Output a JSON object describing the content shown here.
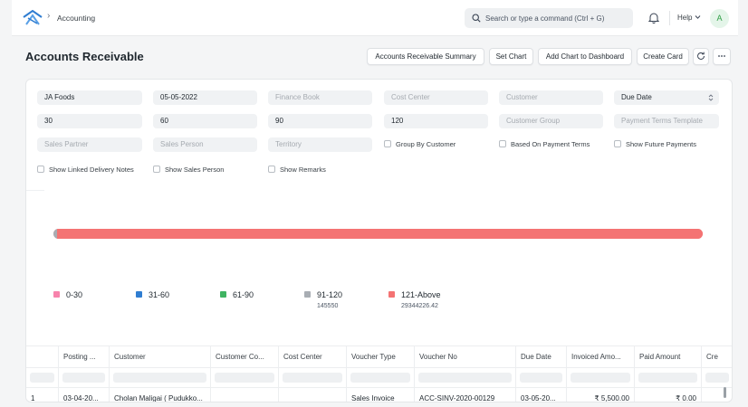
{
  "navbar": {
    "breadcrumb": "Accounting",
    "search_placeholder": "Search or type a command (Ctrl + G)",
    "help_label": "Help",
    "avatar_initial": "A"
  },
  "page": {
    "title": "Accounts Receivable",
    "buttons": {
      "summary": "Accounts Receivable Summary",
      "set_chart": "Set Chart",
      "add_chart": "Add Chart to Dashboard",
      "create_card": "Create Card"
    }
  },
  "filters": {
    "company": "JA Foods",
    "date": "05-05-2022",
    "finance_book": "Finance Book",
    "cost_center": "Cost Center",
    "customer": "Customer",
    "ageing_based_on": "Due Date",
    "range1": "30",
    "range2": "60",
    "range3": "90",
    "range4": "120",
    "customer_group": "Customer Group",
    "payment_terms_template": "Payment Terms Template",
    "sales_partner": "Sales Partner",
    "sales_person": "Sales Person",
    "territory": "Territory",
    "group_by_customer": "Group By Customer",
    "based_on_payment_terms": "Based On Payment Terms",
    "show_future_payments": "Show Future Payments",
    "show_linked_delivery_notes": "Show Linked Delivery Notes",
    "show_sales_person": "Show Sales Person",
    "show_remarks": "Show Remarks"
  },
  "chart_data": {
    "type": "bar",
    "orientation": "horizontal-stacked",
    "categories": [
      "0-30",
      "31-60",
      "61-90",
      "91-120",
      "121-Above"
    ],
    "values": [
      0,
      0,
      0,
      145550,
      29344226.42
    ],
    "value_labels": [
      "",
      "",
      "",
      "145550",
      "29344226.42"
    ],
    "colors": [
      "#f783ac",
      "#2f7dd1",
      "#3fb362",
      "#a8adb3",
      "#f47373"
    ]
  },
  "table": {
    "columns": [
      "",
      "Posting ...",
      "Customer",
      "Customer Co...",
      "Cost Center",
      "Voucher Type",
      "Voucher No",
      "Due Date",
      "Invoiced Amo...",
      "Paid Amount",
      "Cre"
    ],
    "rows": [
      [
        "1",
        "03-04-20...",
        "Cholan Maligai ( Pudukko...",
        "",
        "",
        "Sales Invoice",
        "ACC-SINV-2020-00129",
        "03-05-20...",
        "₹ 5,500.00",
        "₹ 0.00",
        ""
      ]
    ]
  }
}
